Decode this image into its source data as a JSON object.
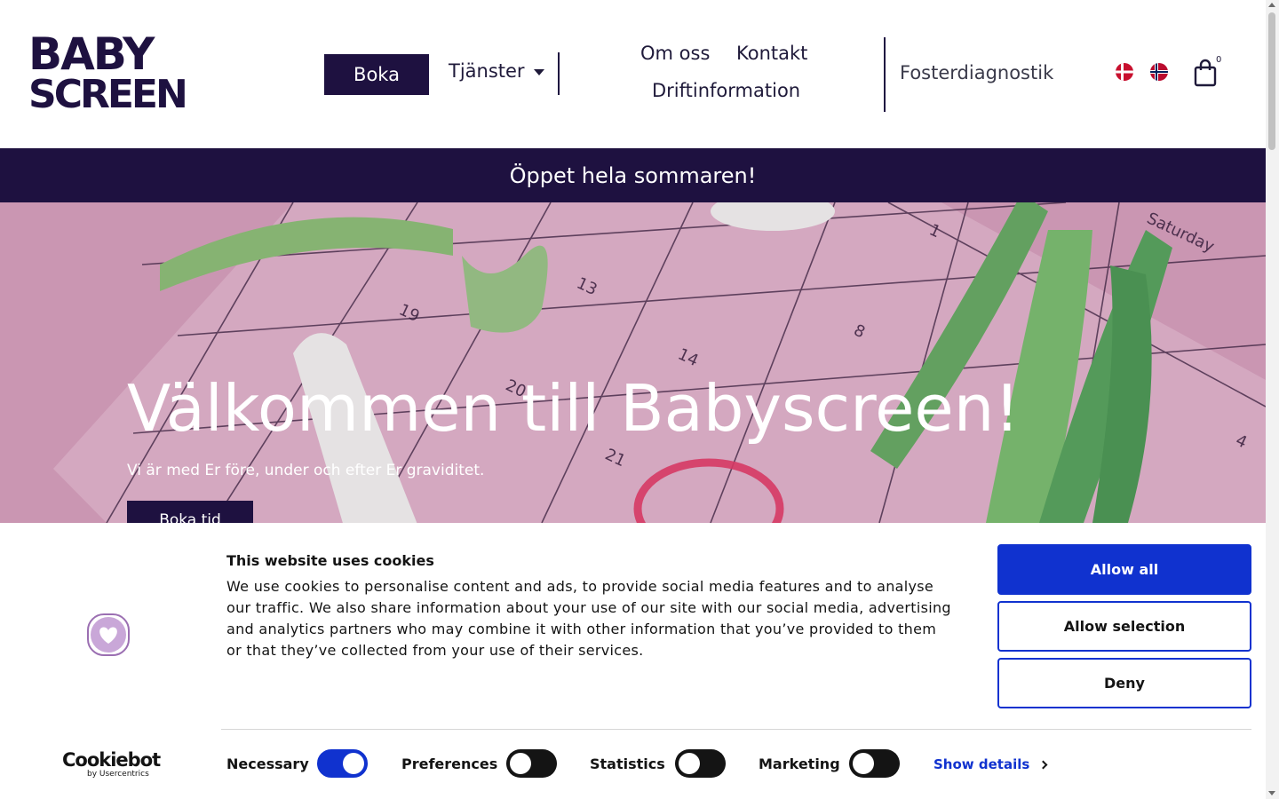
{
  "header": {
    "logo": {
      "line1": "BABY",
      "line2": "SCREEN",
      "alt": "Babyscreen"
    },
    "nav": {
      "boka": "Boka",
      "tjanster": "Tjänster",
      "om_oss": "Om oss",
      "kontakt": "Kontakt",
      "driftinformation": "Driftinformation",
      "fosterdiagnostik": "Fosterdiagnostik"
    },
    "languages": [
      "danish-flag",
      "norwegian-flag"
    ],
    "cart": {
      "icon": "shopping-bag-icon",
      "count": "0"
    }
  },
  "banner": {
    "text": "Öppet hela sommaren!"
  },
  "hero": {
    "title": "Välkommen till Babyscreen!",
    "subtitle": "Vi är med Er före, under och efter Er graviditet.",
    "button": "Boka tid"
  },
  "cookie_banner": {
    "title": "This website uses cookies",
    "text": "We use cookies to personalise content and ads, to provide social media features and to analyse our traffic. We also share information about your use of our site with our social media, advertising and analytics partners who may combine it with other information that you’ve provided to them or that they’ve collected from your use of their services.",
    "buttons": {
      "allow_all": "Allow all",
      "allow_selection": "Allow selection",
      "deny": "Deny"
    },
    "brand": {
      "name": "Cookiebot",
      "by": "by Usercentrics"
    },
    "toggles": [
      {
        "label": "Necessary",
        "on": true
      },
      {
        "label": "Preferences",
        "on": false
      },
      {
        "label": "Statistics",
        "on": false
      },
      {
        "label": "Marketing",
        "on": false
      }
    ],
    "show_details": "Show details"
  },
  "colors": {
    "brand_dark": "#1e1140",
    "cookie_blue": "#1032cf",
    "hero_pink": "#d9a2c0"
  }
}
